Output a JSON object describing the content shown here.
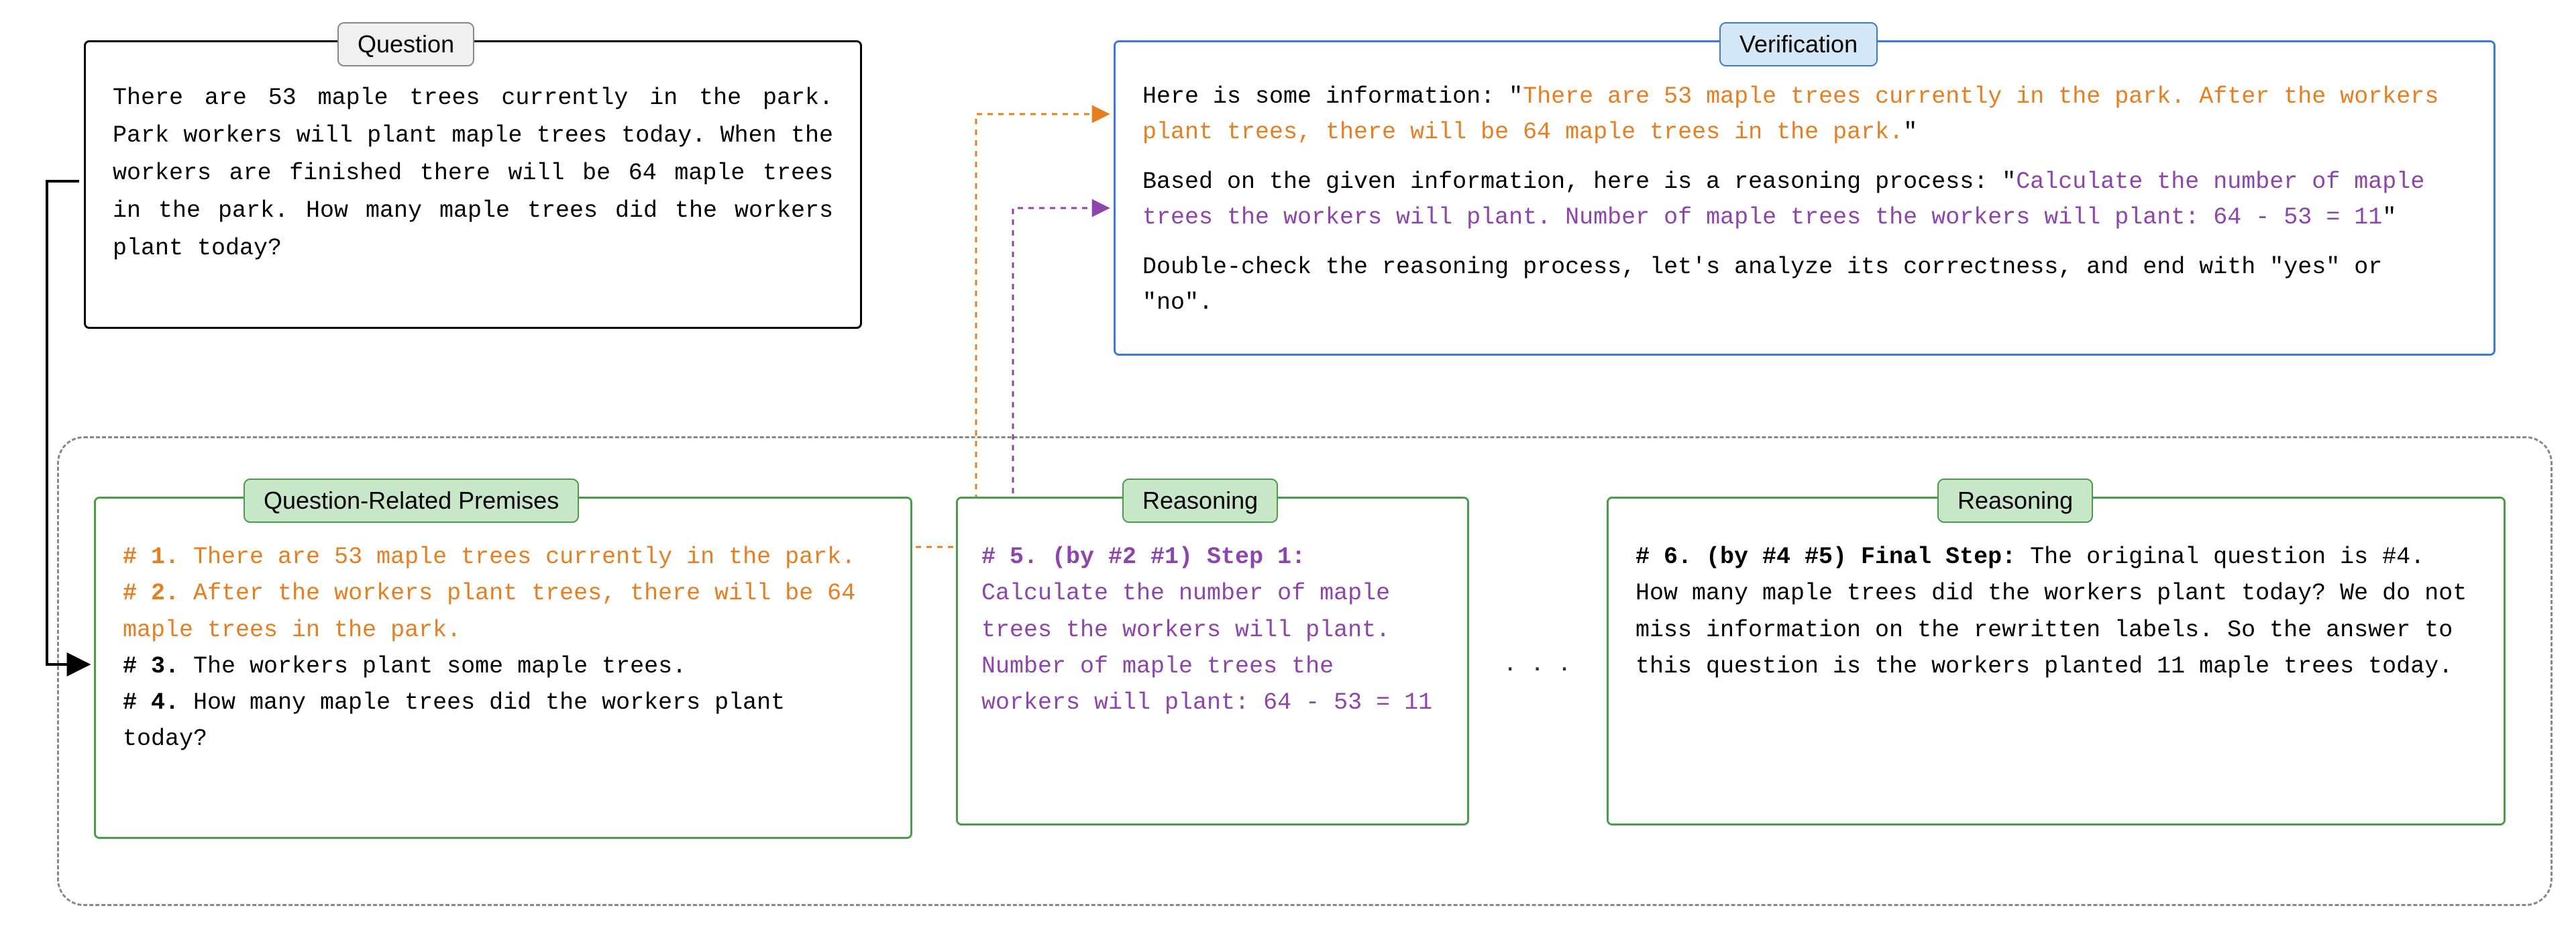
{
  "labels": {
    "question": "Question",
    "verification": "Verification",
    "premises": "Question-Related Premises",
    "reasoning": "Reasoning"
  },
  "question": {
    "text": "There are 53 maple trees currently in the park. Park workers will plant maple trees today. When the workers are finished there will be 64 maple trees in the park. How many maple trees did the workers plant today?"
  },
  "verification": {
    "line1_pre": "Here is some information: \"",
    "line1_orange": "There are 53 maple trees currently in the park. After the workers plant trees, there will be 64 maple trees in the park.",
    "line1_post": "\"",
    "line2_pre": "Based on the given information, here is a reasoning process: \"",
    "line2_purple": "Calculate the number of maple trees the workers will plant. Number of maple trees the workers will plant: 64 - 53 = 11",
    "line2_post": "\"",
    "line3": "Double-check the reasoning process, let's analyze its correctness, and end with \"yes\" or \"no\"."
  },
  "premises": {
    "p1_num": "# 1. ",
    "p1_text": "There are 53 maple trees currently in the park.",
    "p2_num": "# 2. ",
    "p2_text": "After the workers plant trees, there will be 64 maple trees in the park.",
    "p3_num": "# 3.",
    "p3_text": " The workers plant some maple trees.",
    "p4_num": "# 4.",
    "p4_text": " How many maple trees did the workers plant today?"
  },
  "reasoning1": {
    "head": "# 5. (by #2 #1) Step 1:",
    "body": "Calculate the number of maple trees the workers will plant. Number of maple trees the workers will plant: 64 - 53 = 11"
  },
  "reasoning2": {
    "head": "# 6. (by #4 #5) Final Step:",
    "body": " The original question is #4. How many maple trees did the workers plant today? We do not miss information on the rewritten labels. So the answer to this question is the workers planted 11 maple trees today."
  },
  "ellipsis": ". . ."
}
